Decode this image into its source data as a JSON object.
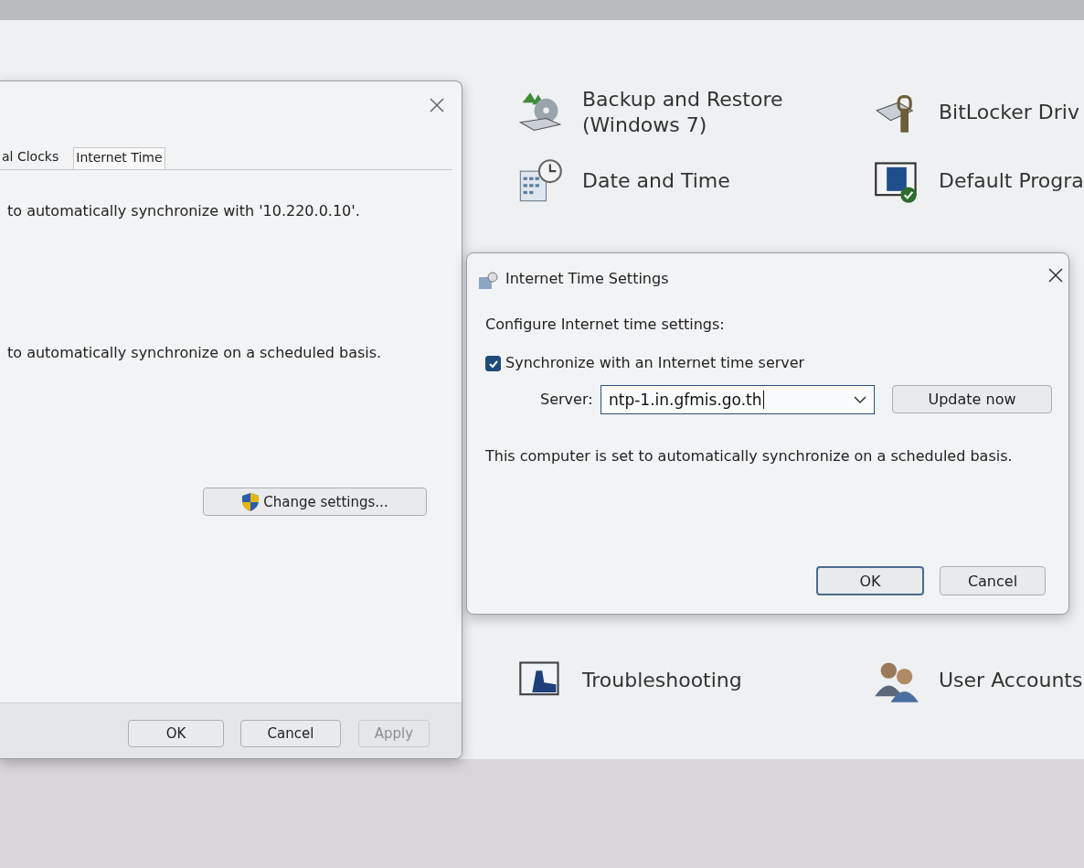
{
  "control_panel": {
    "items": [
      {
        "kind": "backup",
        "label": "Backup and Restore (Windows 7)"
      },
      {
        "kind": "lock",
        "label": "BitLocker Driv"
      },
      {
        "kind": "calendar",
        "label": "Date and Time"
      },
      {
        "kind": "program",
        "label": "Default Progra"
      }
    ],
    "bottom_items": [
      {
        "kind": "troubleshoot",
        "label": "Troubleshooting"
      },
      {
        "kind": "users",
        "label": "User Accounts"
      }
    ]
  },
  "date_time_dialog": {
    "tabs": [
      {
        "label": "al Clocks",
        "selected": false
      },
      {
        "label": "Internet Time",
        "selected": true
      }
    ],
    "lines": [
      "to automatically synchronize with '10.220.0.10'.",
      "to automatically synchronize on a scheduled basis."
    ],
    "change_button": "Change settings...",
    "buttons": [
      {
        "label": "OK",
        "disabled": false
      },
      {
        "label": "Cancel",
        "disabled": false
      },
      {
        "label": "Apply",
        "disabled": true
      }
    ]
  },
  "internet_time_dialog": {
    "title": "Internet Time Settings",
    "heading": "Configure Internet time settings:",
    "sync": {
      "label": "Synchronize with an Internet time server",
      "checked": true
    },
    "server_label": "Server:",
    "server_value": "ntp-1.in.gfmis.go.th",
    "update_button": "Update now",
    "status": "This computer is set to automatically synchronize on a scheduled basis.",
    "buttons": [
      {
        "label": "OK",
        "default": true
      },
      {
        "label": "Cancel",
        "default": false
      }
    ]
  }
}
